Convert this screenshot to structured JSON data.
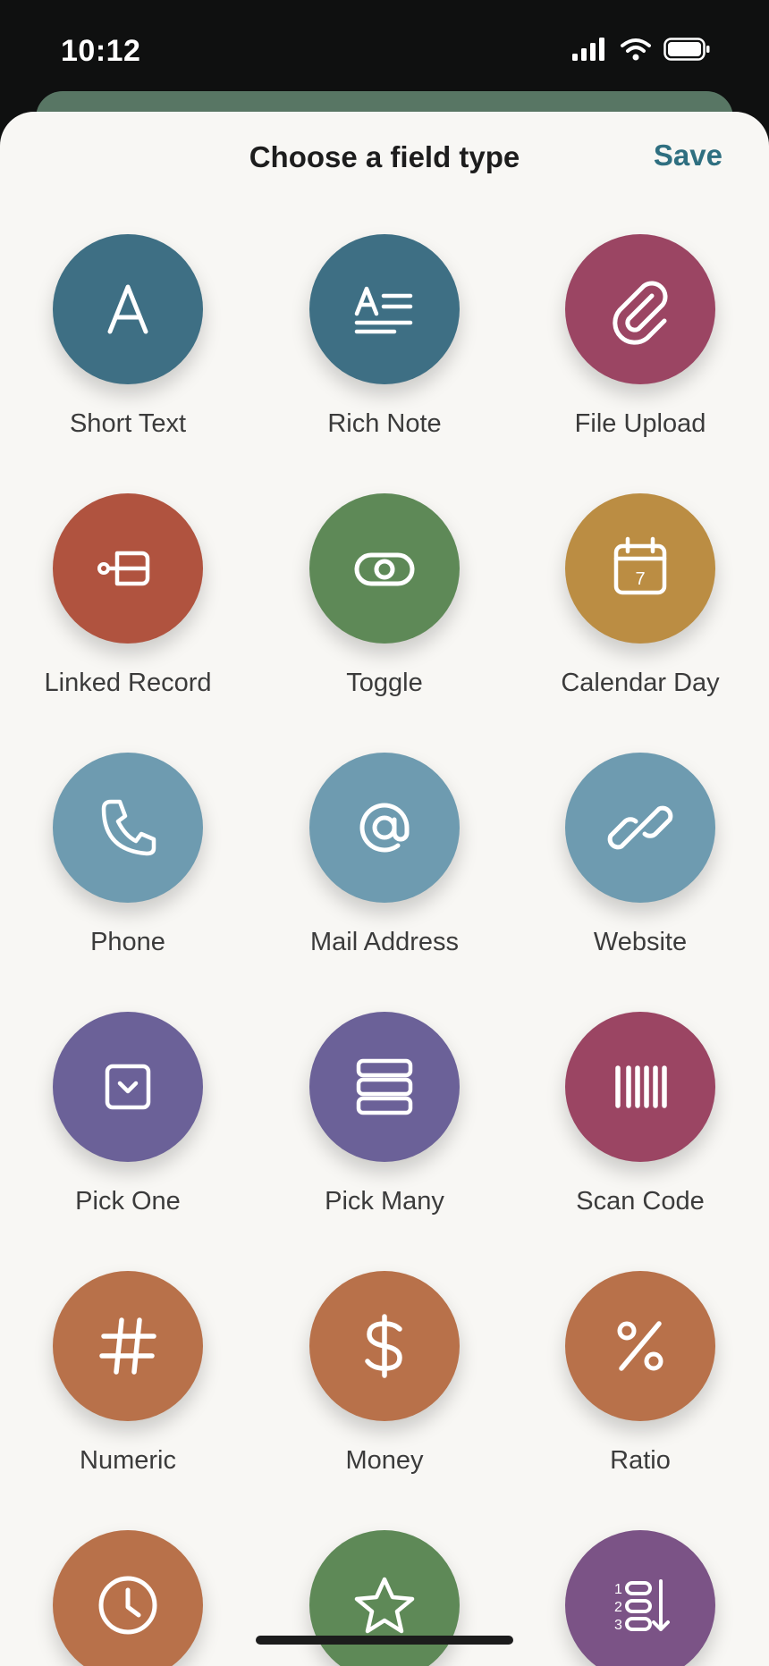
{
  "status": {
    "time": "10:12"
  },
  "header": {
    "title": "Choose a field type",
    "save_label": "Save"
  },
  "colors": {
    "teal": "#3e6f84",
    "berry": "#9b4563",
    "brick": "#b0533f",
    "green": "#5e8957",
    "mustard": "#bb8d43",
    "sky": "#6e9bb0",
    "purple": "#6b6198",
    "orange": "#b8714a",
    "plum": "#7b5386",
    "accent": "#2f6f80"
  },
  "field_types": [
    {
      "label": "Short Text",
      "icon": "letter-a-icon",
      "color": "#3e6f84"
    },
    {
      "label": "Rich Note",
      "icon": "text-lines-icon",
      "color": "#3e6f84"
    },
    {
      "label": "File Upload",
      "icon": "paperclip-icon",
      "color": "#9b4563"
    },
    {
      "label": "Linked Record",
      "icon": "link-record-icon",
      "color": "#b0533f"
    },
    {
      "label": "Toggle",
      "icon": "toggle-icon",
      "color": "#5e8957"
    },
    {
      "label": "Calendar Day",
      "icon": "calendar-icon",
      "color": "#bb8d43"
    },
    {
      "label": "Phone",
      "icon": "phone-icon",
      "color": "#6e9bb0"
    },
    {
      "label": "Mail Address",
      "icon": "at-sign-icon",
      "color": "#6e9bb0"
    },
    {
      "label": "Website",
      "icon": "link-icon",
      "color": "#6e9bb0"
    },
    {
      "label": "Pick One",
      "icon": "dropdown-icon",
      "color": "#6b6198"
    },
    {
      "label": "Pick Many",
      "icon": "stack-icon",
      "color": "#6b6198"
    },
    {
      "label": "Scan Code",
      "icon": "barcode-icon",
      "color": "#9b4563"
    },
    {
      "label": "Numeric",
      "icon": "hash-icon",
      "color": "#b8714a"
    },
    {
      "label": "Money",
      "icon": "dollar-icon",
      "color": "#b8714a"
    },
    {
      "label": "Ratio",
      "icon": "percent-icon",
      "color": "#b8714a"
    },
    {
      "label": "",
      "icon": "clock-icon",
      "color": "#b8714a"
    },
    {
      "label": "",
      "icon": "star-icon",
      "color": "#5e8957"
    },
    {
      "label": "",
      "icon": "numbered-list-icon",
      "color": "#7b5386"
    }
  ]
}
